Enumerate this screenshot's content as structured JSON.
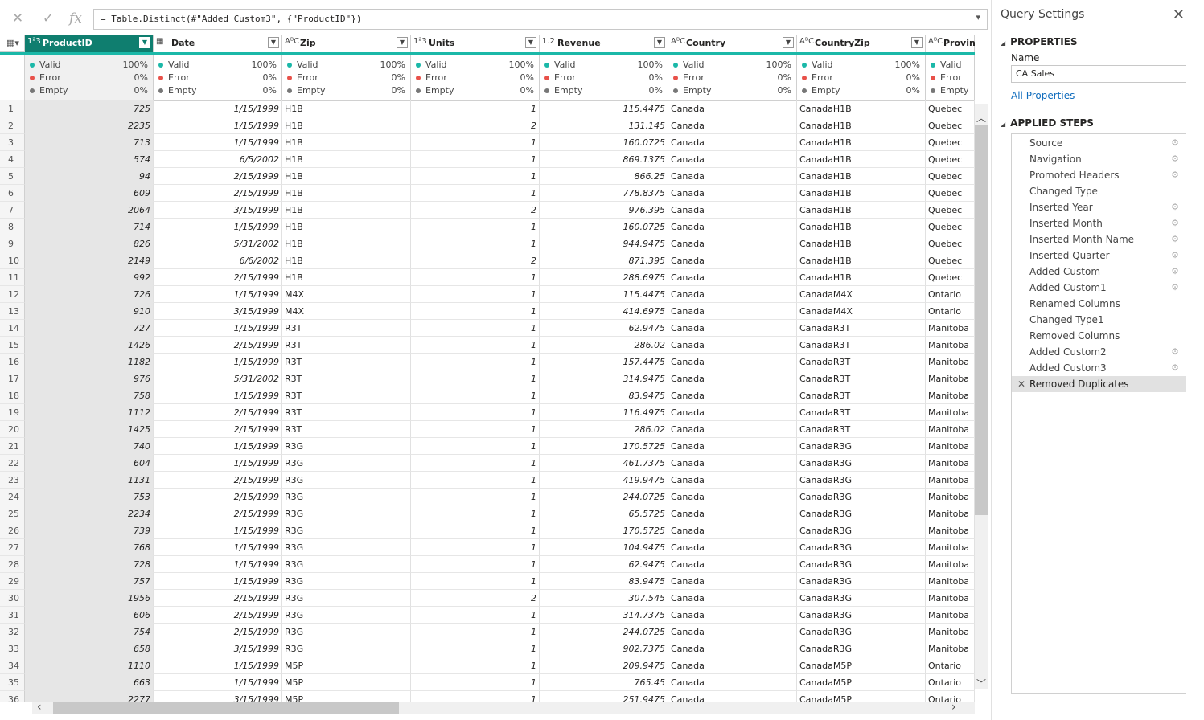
{
  "formula": {
    "text": "= Table.Distinct(#\"Added Custom3\", {\"ProductID\"})"
  },
  "columns": [
    {
      "type": "1²3",
      "name": "ProductID",
      "align": "num"
    },
    {
      "type": "▦",
      "name": "Date",
      "align": "num"
    },
    {
      "type": "AᴮC",
      "name": "Zip",
      "align": "text"
    },
    {
      "type": "1²3",
      "name": "Units",
      "align": "num"
    },
    {
      "type": "1.2",
      "name": "Revenue",
      "align": "num"
    },
    {
      "type": "AᴮC",
      "name": "Country",
      "align": "text"
    },
    {
      "type": "AᴮC",
      "name": "CountryZip",
      "align": "text"
    },
    {
      "type": "AᴮC",
      "name": "Province",
      "align": "text"
    }
  ],
  "quality": {
    "labels": [
      "Valid",
      "Error",
      "Empty"
    ],
    "values": [
      "100%",
      "0%",
      "0%"
    ],
    "colors": [
      "#1bb8a8",
      "#e8514a",
      "#777777"
    ]
  },
  "rows": [
    [
      "1",
      "725",
      "1/15/1999",
      "H1B",
      "1",
      "115.4475",
      "Canada",
      "CanadaH1B",
      "Quebec"
    ],
    [
      "2",
      "2235",
      "1/15/1999",
      "H1B",
      "2",
      "131.145",
      "Canada",
      "CanadaH1B",
      "Quebec"
    ],
    [
      "3",
      "713",
      "1/15/1999",
      "H1B",
      "1",
      "160.0725",
      "Canada",
      "CanadaH1B",
      "Quebec"
    ],
    [
      "4",
      "574",
      "6/5/2002",
      "H1B",
      "1",
      "869.1375",
      "Canada",
      "CanadaH1B",
      "Quebec"
    ],
    [
      "5",
      "94",
      "2/15/1999",
      "H1B",
      "1",
      "866.25",
      "Canada",
      "CanadaH1B",
      "Quebec"
    ],
    [
      "6",
      "609",
      "2/15/1999",
      "H1B",
      "1",
      "778.8375",
      "Canada",
      "CanadaH1B",
      "Quebec"
    ],
    [
      "7",
      "2064",
      "3/15/1999",
      "H1B",
      "2",
      "976.395",
      "Canada",
      "CanadaH1B",
      "Quebec"
    ],
    [
      "8",
      "714",
      "1/15/1999",
      "H1B",
      "1",
      "160.0725",
      "Canada",
      "CanadaH1B",
      "Quebec"
    ],
    [
      "9",
      "826",
      "5/31/2002",
      "H1B",
      "1",
      "944.9475",
      "Canada",
      "CanadaH1B",
      "Quebec"
    ],
    [
      "10",
      "2149",
      "6/6/2002",
      "H1B",
      "2",
      "871.395",
      "Canada",
      "CanadaH1B",
      "Quebec"
    ],
    [
      "11",
      "992",
      "2/15/1999",
      "H1B",
      "1",
      "288.6975",
      "Canada",
      "CanadaH1B",
      "Quebec"
    ],
    [
      "12",
      "726",
      "1/15/1999",
      "M4X",
      "1",
      "115.4475",
      "Canada",
      "CanadaM4X",
      "Ontario"
    ],
    [
      "13",
      "910",
      "3/15/1999",
      "M4X",
      "1",
      "414.6975",
      "Canada",
      "CanadaM4X",
      "Ontario"
    ],
    [
      "14",
      "727",
      "1/15/1999",
      "R3T",
      "1",
      "62.9475",
      "Canada",
      "CanadaR3T",
      "Manitoba"
    ],
    [
      "15",
      "1426",
      "2/15/1999",
      "R3T",
      "1",
      "286.02",
      "Canada",
      "CanadaR3T",
      "Manitoba"
    ],
    [
      "16",
      "1182",
      "1/15/1999",
      "R3T",
      "1",
      "157.4475",
      "Canada",
      "CanadaR3T",
      "Manitoba"
    ],
    [
      "17",
      "976",
      "5/31/2002",
      "R3T",
      "1",
      "314.9475",
      "Canada",
      "CanadaR3T",
      "Manitoba"
    ],
    [
      "18",
      "758",
      "1/15/1999",
      "R3T",
      "1",
      "83.9475",
      "Canada",
      "CanadaR3T",
      "Manitoba"
    ],
    [
      "19",
      "1112",
      "2/15/1999",
      "R3T",
      "1",
      "116.4975",
      "Canada",
      "CanadaR3T",
      "Manitoba"
    ],
    [
      "20",
      "1425",
      "2/15/1999",
      "R3T",
      "1",
      "286.02",
      "Canada",
      "CanadaR3T",
      "Manitoba"
    ],
    [
      "21",
      "740",
      "1/15/1999",
      "R3G",
      "1",
      "170.5725",
      "Canada",
      "CanadaR3G",
      "Manitoba"
    ],
    [
      "22",
      "604",
      "1/15/1999",
      "R3G",
      "1",
      "461.7375",
      "Canada",
      "CanadaR3G",
      "Manitoba"
    ],
    [
      "23",
      "1131",
      "2/15/1999",
      "R3G",
      "1",
      "419.9475",
      "Canada",
      "CanadaR3G",
      "Manitoba"
    ],
    [
      "24",
      "753",
      "2/15/1999",
      "R3G",
      "1",
      "244.0725",
      "Canada",
      "CanadaR3G",
      "Manitoba"
    ],
    [
      "25",
      "2234",
      "2/15/1999",
      "R3G",
      "1",
      "65.5725",
      "Canada",
      "CanadaR3G",
      "Manitoba"
    ],
    [
      "26",
      "739",
      "1/15/1999",
      "R3G",
      "1",
      "170.5725",
      "Canada",
      "CanadaR3G",
      "Manitoba"
    ],
    [
      "27",
      "768",
      "1/15/1999",
      "R3G",
      "1",
      "104.9475",
      "Canada",
      "CanadaR3G",
      "Manitoba"
    ],
    [
      "28",
      "728",
      "1/15/1999",
      "R3G",
      "1",
      "62.9475",
      "Canada",
      "CanadaR3G",
      "Manitoba"
    ],
    [
      "29",
      "757",
      "1/15/1999",
      "R3G",
      "1",
      "83.9475",
      "Canada",
      "CanadaR3G",
      "Manitoba"
    ],
    [
      "30",
      "1956",
      "2/15/1999",
      "R3G",
      "2",
      "307.545",
      "Canada",
      "CanadaR3G",
      "Manitoba"
    ],
    [
      "31",
      "606",
      "2/15/1999",
      "R3G",
      "1",
      "314.7375",
      "Canada",
      "CanadaR3G",
      "Manitoba"
    ],
    [
      "32",
      "754",
      "2/15/1999",
      "R3G",
      "1",
      "244.0725",
      "Canada",
      "CanadaR3G",
      "Manitoba"
    ],
    [
      "33",
      "658",
      "3/15/1999",
      "R3G",
      "1",
      "902.7375",
      "Canada",
      "CanadaR3G",
      "Manitoba"
    ],
    [
      "34",
      "1110",
      "1/15/1999",
      "M5P",
      "1",
      "209.9475",
      "Canada",
      "CanadaM5P",
      "Ontario"
    ],
    [
      "35",
      "663",
      "1/15/1999",
      "M5P",
      "1",
      "765.45",
      "Canada",
      "CanadaM5P",
      "Ontario"
    ],
    [
      "36",
      "2277",
      "3/15/1999",
      "M5P",
      "1",
      "251.9475",
      "Canada",
      "CanadaM5P",
      "Ontario"
    ]
  ],
  "panel": {
    "title": "Query Settings",
    "properties_heading": "PROPERTIES",
    "name_label": "Name",
    "name_value": "CA Sales",
    "all_properties": "All Properties",
    "steps_heading": "APPLIED STEPS",
    "steps": [
      {
        "name": "Source",
        "gear": true
      },
      {
        "name": "Navigation",
        "gear": true
      },
      {
        "name": "Promoted Headers",
        "gear": true
      },
      {
        "name": "Changed Type",
        "gear": false
      },
      {
        "name": "Inserted Year",
        "gear": true
      },
      {
        "name": "Inserted Month",
        "gear": true
      },
      {
        "name": "Inserted Month Name",
        "gear": true
      },
      {
        "name": "Inserted Quarter",
        "gear": true
      },
      {
        "name": "Added Custom",
        "gear": true
      },
      {
        "name": "Added Custom1",
        "gear": true
      },
      {
        "name": "Renamed Columns",
        "gear": false
      },
      {
        "name": "Changed Type1",
        "gear": false
      },
      {
        "name": "Removed Columns",
        "gear": false
      },
      {
        "name": "Added Custom2",
        "gear": true
      },
      {
        "name": "Added Custom3",
        "gear": true
      },
      {
        "name": "Removed Duplicates",
        "gear": false,
        "active": true
      }
    ]
  }
}
